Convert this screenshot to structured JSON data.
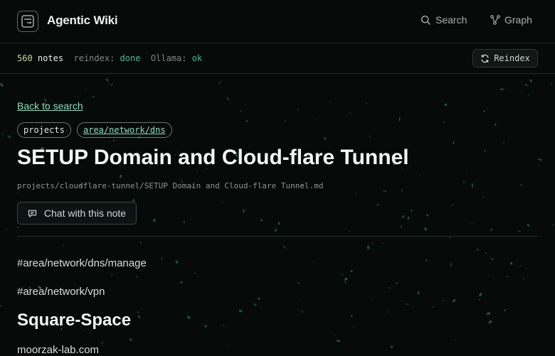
{
  "app": {
    "brand": "Agentic Wiki",
    "nav": {
      "search_label": "Search",
      "graph_label": "Graph"
    }
  },
  "status": {
    "notes_count": "560",
    "notes_label": "notes",
    "reindex_key": "reindex:",
    "reindex_value": "done",
    "ollama_key": "Ollama:",
    "ollama_value": "ok",
    "reindex_button": "Reindex"
  },
  "note": {
    "back_label": "Back to search",
    "tags": [
      "projects",
      "area/network/dns"
    ],
    "title": "SETUP Domain and Cloud-flare Tunnel",
    "path": "projects/cloudflare-tunnel/SETUP Domain and Cloud-flare Tunnel.md",
    "chat_label": "Chat with this note",
    "hashtags": [
      "#area/network/dns/manage",
      "#area/network/vpn"
    ],
    "section_heading": "Square-Space",
    "body_line": "moorzak-lab.com"
  },
  "colors": {
    "background": "#060a09",
    "accent": "#8fdcc0",
    "ok": "#4fb894",
    "border": "#232a28"
  },
  "icons": {
    "logo": "terminal-window-icon",
    "search": "search-icon",
    "graph": "graph-nodes-icon",
    "reindex": "refresh-icon",
    "chat": "chat-bubble-icon"
  }
}
